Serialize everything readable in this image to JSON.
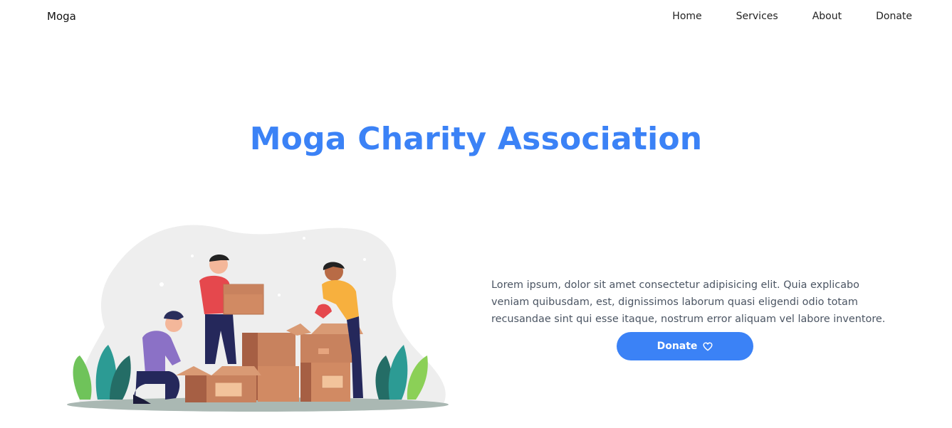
{
  "brand": "Moga",
  "nav": {
    "items": [
      {
        "label": "Home"
      },
      {
        "label": "Services"
      },
      {
        "label": "About"
      },
      {
        "label": "Donate"
      }
    ]
  },
  "hero": {
    "title": "Moga Charity Association",
    "description": "Lorem ipsum, dolor sit amet consectetur adipisicing elit. Quia explicabo veniam quibusdam, est, dignissimos laborum quasi eligendi odio totam recusandae sint qui esse itaque, nostrum error aliquam vel labore inventore.",
    "donate_label": "Donate",
    "donate_icon": "heart-icon"
  },
  "colors": {
    "accent": "#3b82f6",
    "text": "#4b5563"
  }
}
